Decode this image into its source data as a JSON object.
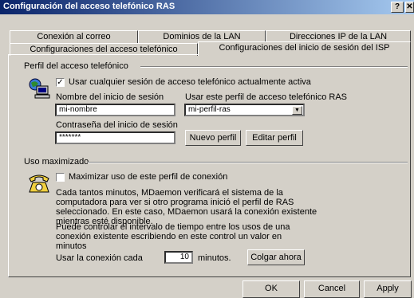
{
  "window": {
    "title": "Configuración del acceso telefónico RAS",
    "help_btn": "?",
    "close_btn": "✕"
  },
  "tabs_row1": [
    "Conexión al correo",
    "Dominios de la LAN",
    "Direcciones IP de la LAN"
  ],
  "tabs_row2": [
    "Configuraciones del acceso telefónico",
    "Configuraciones del inicio de sesión del ISP"
  ],
  "profile": {
    "group_label": "Perfil del acceso telefónico",
    "use_any_session": {
      "label": "Usar cualquier sesión de acceso telefónico actualmente activa",
      "checked": true
    },
    "login_name_label": "Nombre del inicio de sesión",
    "login_name_value": "mi-nombre",
    "use_profile_label": "Usar este perfil de acceso telefónico RAS",
    "profile_selected": "mi-perfil-ras",
    "password_label": "Contraseña del inicio de sesión",
    "password_value": "*******",
    "new_profile_btn": "Nuevo perfil",
    "edit_profile_btn": "Editar perfil"
  },
  "maximize": {
    "group_label": "Uso maximizado",
    "checkbox_label": "Maximizar uso de este perfil de conexión",
    "checked": false,
    "desc1": "Cada tantos minutos, MDaemon verificará el sistema de la computadora para ver si otro programa inició el perfil de RAS seleccionado. En este caso, MDaemon usará la conexión existente mientras esté disponible.",
    "desc2": "Puede controlar el intervalo de tiempo entre los usos de una conexión existente escribiendo en este control un valor en minutos",
    "use_every_label": "Usar la conexión cada",
    "minutes_value": "10",
    "minutes_label": "minutos.",
    "hang_up_btn": "Colgar ahora"
  },
  "footer": {
    "ok": "OK",
    "cancel": "Cancel",
    "apply": "Apply"
  }
}
